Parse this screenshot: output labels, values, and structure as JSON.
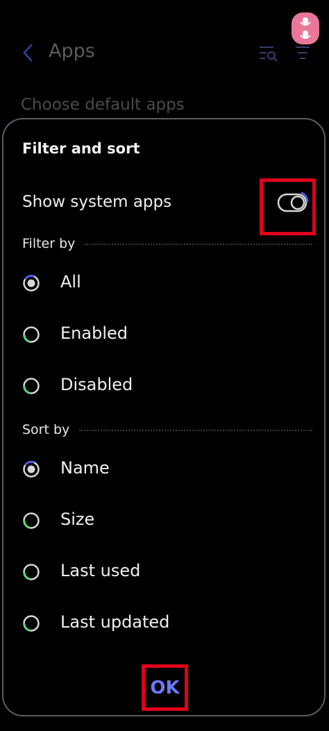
{
  "background": {
    "title": "Apps",
    "subtitle": "Choose default apps",
    "icons": [
      "back-icon",
      "filter-search-icon",
      "sort-icon",
      "voice-access-icon"
    ]
  },
  "dialog": {
    "title": "Filter and sort",
    "toggle": {
      "label": "Show system apps",
      "checked": false
    },
    "filter": {
      "header": "Filter by",
      "options": [
        {
          "label": "All",
          "selected": true
        },
        {
          "label": "Enabled",
          "selected": false
        },
        {
          "label": "Disabled",
          "selected": false
        }
      ]
    },
    "sort": {
      "header": "Sort by",
      "options": [
        {
          "label": "Name",
          "selected": true
        },
        {
          "label": "Size",
          "selected": false
        },
        {
          "label": "Last used",
          "selected": false
        },
        {
          "label": "Last updated",
          "selected": false
        }
      ]
    },
    "ok_label": "OK"
  },
  "colors": {
    "accent": "#6d78ff",
    "highlight": "#e0001a",
    "voice_pill": "#e9779a",
    "radio_ring_accent": "#5cd67a"
  }
}
